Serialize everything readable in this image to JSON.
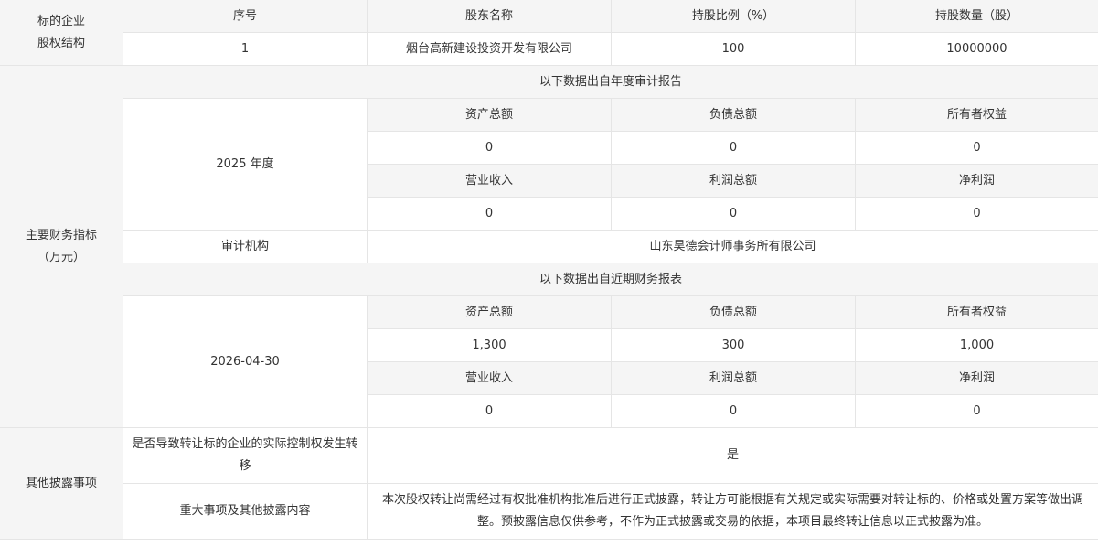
{
  "equity": {
    "section_label_line1": "标的企业",
    "section_label_line2": "股权结构",
    "headers": [
      "序号",
      "股东名称",
      "持股比例（%）",
      "持股数量（股）"
    ],
    "rows": [
      {
        "index": "1",
        "name": "烟台高新建设投资开发有限公司",
        "ratio": "100",
        "shares": "10000000"
      }
    ]
  },
  "finance": {
    "section_label_line1": "主要财务指标",
    "section_label_line2": "（万元）",
    "annual": {
      "caption": "以下数据出自年度审计报告",
      "period": "2025 年度",
      "labels1": [
        "资产总额",
        "负债总额",
        "所有者权益"
      ],
      "values1": [
        "0",
        "0",
        "0"
      ],
      "labels2": [
        "营业收入",
        "利润总额",
        "净利润"
      ],
      "values2": [
        "0",
        "0",
        "0"
      ]
    },
    "auditor_label": "审计机构",
    "auditor_value": "山东昊德会计师事务所有限公司",
    "recent": {
      "caption": "以下数据出自近期财务报表",
      "period": "2026-04-30",
      "labels1": [
        "资产总额",
        "负债总额",
        "所有者权益"
      ],
      "values1": [
        "1,300",
        "300",
        "1,000"
      ],
      "labels2": [
        "营业收入",
        "利润总额",
        "净利润"
      ],
      "values2": [
        "0",
        "0",
        "0"
      ]
    }
  },
  "other": {
    "section_label": "其他披露事项",
    "control_change_label": "是否导致转让标的企业的实际控制权发生转移",
    "control_change_value": "是",
    "major_label": "重大事项及其他披露内容",
    "major_value": "本次股权转让尚需经过有权批准机构批准后进行正式披露，转让方可能根据有关规定或实际需要对转让标的、价格或处置方案等做出调整。预披露信息仅供参考，不作为正式披露或交易的依据，本项目最终转让信息以正式披露为准。"
  }
}
